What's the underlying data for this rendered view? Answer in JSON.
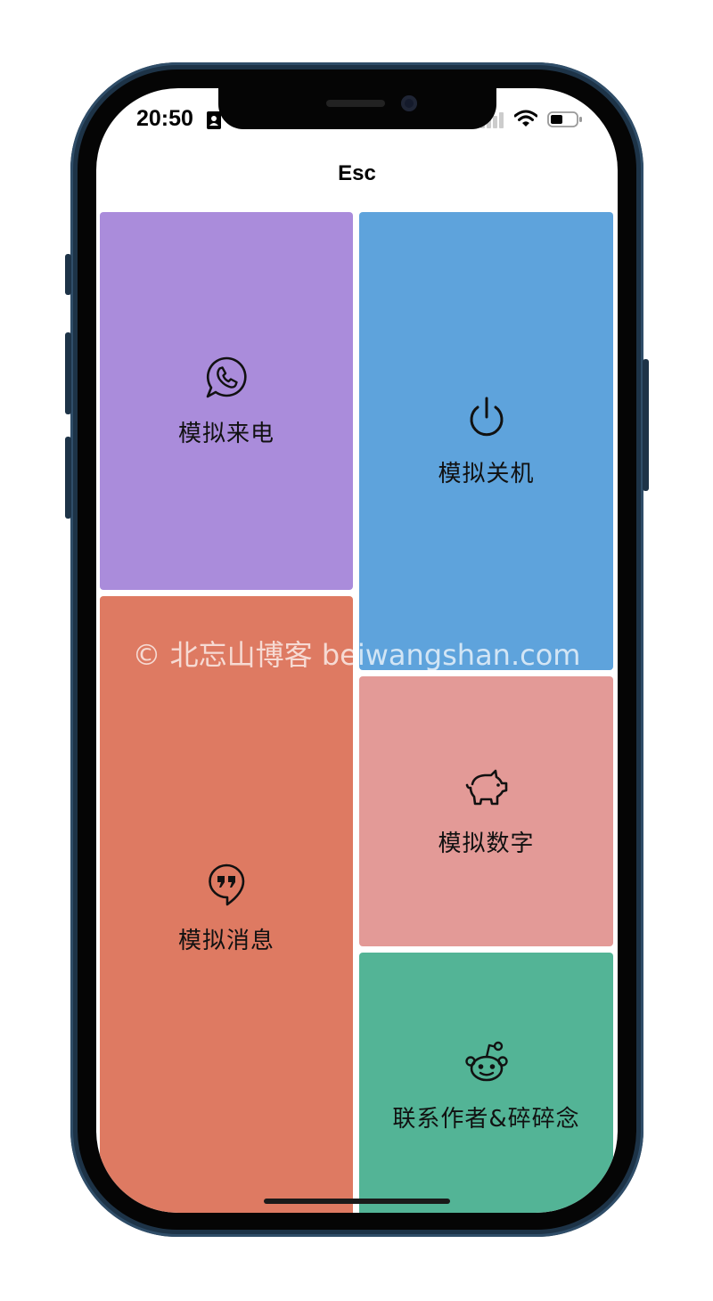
{
  "status_bar": {
    "time": "20:50",
    "icons": [
      "contact-card-icon",
      "signal-icon",
      "wifi-icon",
      "battery-icon"
    ]
  },
  "nav": {
    "title": "Esc"
  },
  "tiles": [
    {
      "label": "模拟来电",
      "icon": "whatsapp-phone-icon",
      "color": "#aa8cdb"
    },
    {
      "label": "模拟关机",
      "icon": "power-icon",
      "color": "#5ea3dc"
    },
    {
      "label": "模拟消息",
      "icon": "hangouts-quote-icon",
      "color": "#de7a62"
    },
    {
      "label": "模拟数字",
      "icon": "piggy-bank-icon",
      "color": "#e39a97"
    },
    {
      "label": "联系作者&碎碎念",
      "icon": "reddit-icon",
      "color": "#53b496"
    }
  ],
  "watermark": "© 北忘山博客 beiwangshan.com"
}
